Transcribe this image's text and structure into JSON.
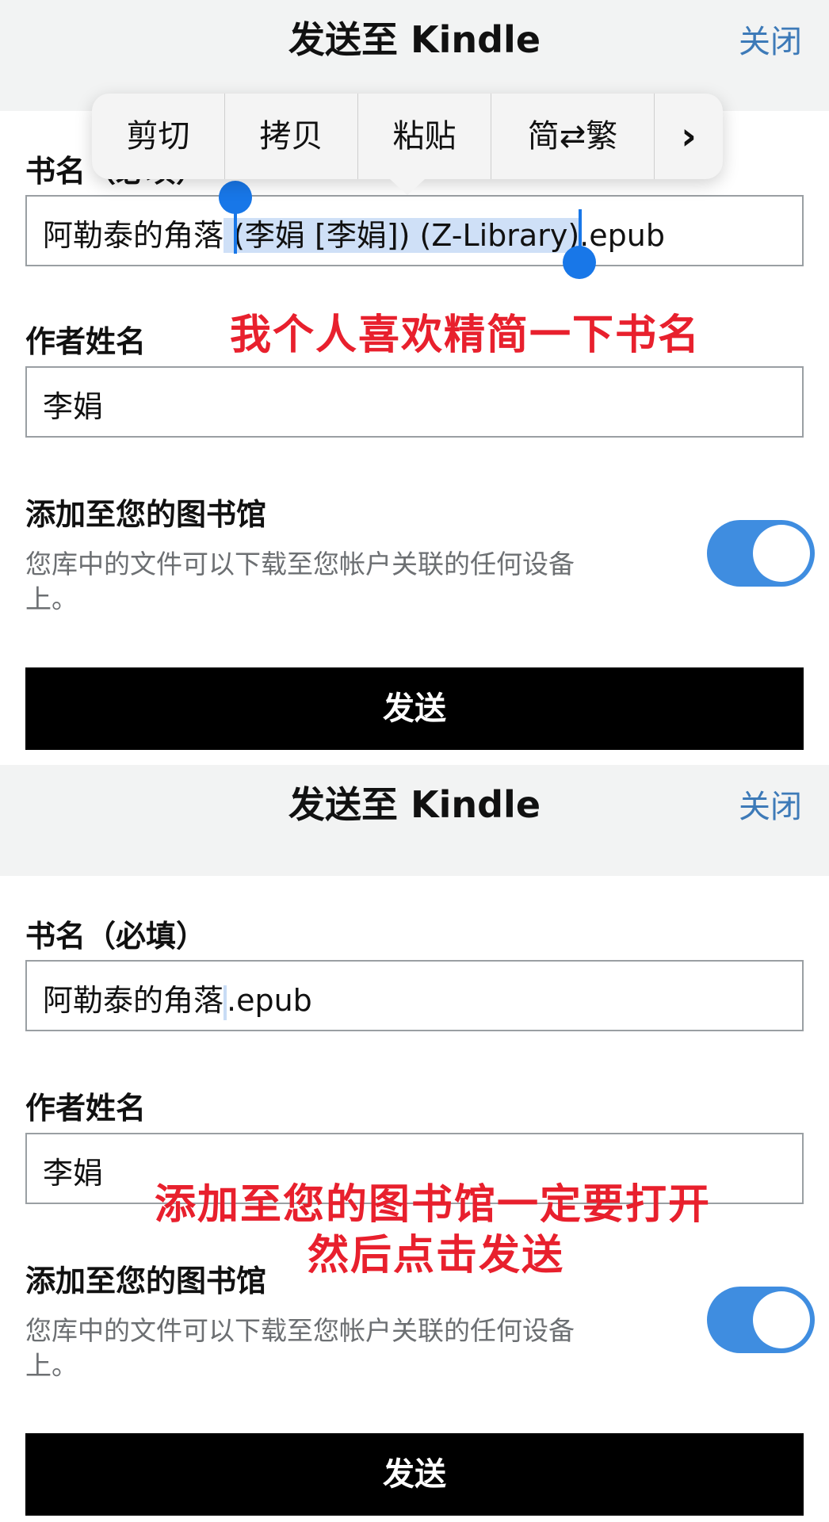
{
  "panel1": {
    "title": "发送至 Kindle",
    "close": "关闭",
    "book_label": "书名（必填）",
    "book_value_prefix": "阿勒泰的角落",
    "book_value_selected": " (李娟 [李娟]) (Z-Library)",
    "book_value_suffix": ".epub",
    "author_label": "作者姓名",
    "author_value": "李娟",
    "library_label": "添加至您的图书馆",
    "library_desc": "您库中的文件可以下载至您帐户关联的任何设备上。",
    "library_toggle_on": true,
    "send_label": "发送",
    "note": "我个人喜欢精简一下书名",
    "context_menu": [
      "剪切",
      "拷贝",
      "粘贴",
      "简⇄繁",
      "›"
    ]
  },
  "panel2": {
    "title": "发送至 Kindle",
    "close": "关闭",
    "book_label": "书名（必填）",
    "book_value_prefix": "阿勒泰的角落",
    "book_value_suffix": ".epub",
    "author_label": "作者姓名",
    "author_value": "李娟",
    "library_label": "添加至您的图书馆",
    "library_desc": "您库中的文件可以下载至您帐户关联的任何设备上。",
    "library_toggle_on": true,
    "send_label": "发送",
    "note_line1": "添加至您的图书馆一定要打开",
    "note_line2": "然后点击发送"
  },
  "colors": {
    "accent_blue": "#3f8de0",
    "close_link": "#3d7ab8",
    "annotation_red": "#e8202d",
    "selection": "#cfe0f7"
  }
}
